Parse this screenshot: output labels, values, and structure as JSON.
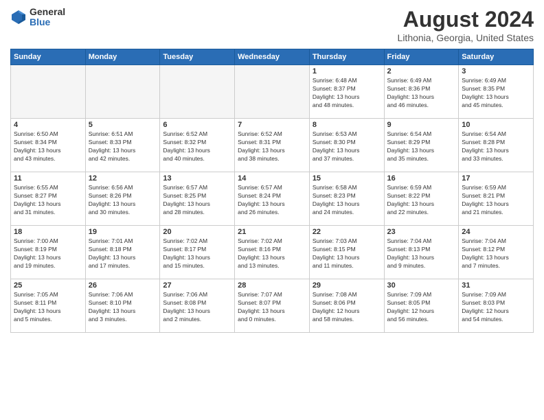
{
  "header": {
    "logo_general": "General",
    "logo_blue": "Blue",
    "main_title": "August 2024",
    "subtitle": "Lithonia, Georgia, United States"
  },
  "calendar": {
    "days_of_week": [
      "Sunday",
      "Monday",
      "Tuesday",
      "Wednesday",
      "Thursday",
      "Friday",
      "Saturday"
    ],
    "weeks": [
      [
        {
          "day": "",
          "info": ""
        },
        {
          "day": "",
          "info": ""
        },
        {
          "day": "",
          "info": ""
        },
        {
          "day": "",
          "info": ""
        },
        {
          "day": "1",
          "info": "Sunrise: 6:48 AM\nSunset: 8:37 PM\nDaylight: 13 hours\nand 48 minutes."
        },
        {
          "day": "2",
          "info": "Sunrise: 6:49 AM\nSunset: 8:36 PM\nDaylight: 13 hours\nand 46 minutes."
        },
        {
          "day": "3",
          "info": "Sunrise: 6:49 AM\nSunset: 8:35 PM\nDaylight: 13 hours\nand 45 minutes."
        }
      ],
      [
        {
          "day": "4",
          "info": "Sunrise: 6:50 AM\nSunset: 8:34 PM\nDaylight: 13 hours\nand 43 minutes."
        },
        {
          "day": "5",
          "info": "Sunrise: 6:51 AM\nSunset: 8:33 PM\nDaylight: 13 hours\nand 42 minutes."
        },
        {
          "day": "6",
          "info": "Sunrise: 6:52 AM\nSunset: 8:32 PM\nDaylight: 13 hours\nand 40 minutes."
        },
        {
          "day": "7",
          "info": "Sunrise: 6:52 AM\nSunset: 8:31 PM\nDaylight: 13 hours\nand 38 minutes."
        },
        {
          "day": "8",
          "info": "Sunrise: 6:53 AM\nSunset: 8:30 PM\nDaylight: 13 hours\nand 37 minutes."
        },
        {
          "day": "9",
          "info": "Sunrise: 6:54 AM\nSunset: 8:29 PM\nDaylight: 13 hours\nand 35 minutes."
        },
        {
          "day": "10",
          "info": "Sunrise: 6:54 AM\nSunset: 8:28 PM\nDaylight: 13 hours\nand 33 minutes."
        }
      ],
      [
        {
          "day": "11",
          "info": "Sunrise: 6:55 AM\nSunset: 8:27 PM\nDaylight: 13 hours\nand 31 minutes."
        },
        {
          "day": "12",
          "info": "Sunrise: 6:56 AM\nSunset: 8:26 PM\nDaylight: 13 hours\nand 30 minutes."
        },
        {
          "day": "13",
          "info": "Sunrise: 6:57 AM\nSunset: 8:25 PM\nDaylight: 13 hours\nand 28 minutes."
        },
        {
          "day": "14",
          "info": "Sunrise: 6:57 AM\nSunset: 8:24 PM\nDaylight: 13 hours\nand 26 minutes."
        },
        {
          "day": "15",
          "info": "Sunrise: 6:58 AM\nSunset: 8:23 PM\nDaylight: 13 hours\nand 24 minutes."
        },
        {
          "day": "16",
          "info": "Sunrise: 6:59 AM\nSunset: 8:22 PM\nDaylight: 13 hours\nand 22 minutes."
        },
        {
          "day": "17",
          "info": "Sunrise: 6:59 AM\nSunset: 8:21 PM\nDaylight: 13 hours\nand 21 minutes."
        }
      ],
      [
        {
          "day": "18",
          "info": "Sunrise: 7:00 AM\nSunset: 8:19 PM\nDaylight: 13 hours\nand 19 minutes."
        },
        {
          "day": "19",
          "info": "Sunrise: 7:01 AM\nSunset: 8:18 PM\nDaylight: 13 hours\nand 17 minutes."
        },
        {
          "day": "20",
          "info": "Sunrise: 7:02 AM\nSunset: 8:17 PM\nDaylight: 13 hours\nand 15 minutes."
        },
        {
          "day": "21",
          "info": "Sunrise: 7:02 AM\nSunset: 8:16 PM\nDaylight: 13 hours\nand 13 minutes."
        },
        {
          "day": "22",
          "info": "Sunrise: 7:03 AM\nSunset: 8:15 PM\nDaylight: 13 hours\nand 11 minutes."
        },
        {
          "day": "23",
          "info": "Sunrise: 7:04 AM\nSunset: 8:13 PM\nDaylight: 13 hours\nand 9 minutes."
        },
        {
          "day": "24",
          "info": "Sunrise: 7:04 AM\nSunset: 8:12 PM\nDaylight: 13 hours\nand 7 minutes."
        }
      ],
      [
        {
          "day": "25",
          "info": "Sunrise: 7:05 AM\nSunset: 8:11 PM\nDaylight: 13 hours\nand 5 minutes."
        },
        {
          "day": "26",
          "info": "Sunrise: 7:06 AM\nSunset: 8:10 PM\nDaylight: 13 hours\nand 3 minutes."
        },
        {
          "day": "27",
          "info": "Sunrise: 7:06 AM\nSunset: 8:08 PM\nDaylight: 13 hours\nand 2 minutes."
        },
        {
          "day": "28",
          "info": "Sunrise: 7:07 AM\nSunset: 8:07 PM\nDaylight: 13 hours\nand 0 minutes."
        },
        {
          "day": "29",
          "info": "Sunrise: 7:08 AM\nSunset: 8:06 PM\nDaylight: 12 hours\nand 58 minutes."
        },
        {
          "day": "30",
          "info": "Sunrise: 7:09 AM\nSunset: 8:05 PM\nDaylight: 12 hours\nand 56 minutes."
        },
        {
          "day": "31",
          "info": "Sunrise: 7:09 AM\nSunset: 8:03 PM\nDaylight: 12 hours\nand 54 minutes."
        }
      ]
    ]
  }
}
